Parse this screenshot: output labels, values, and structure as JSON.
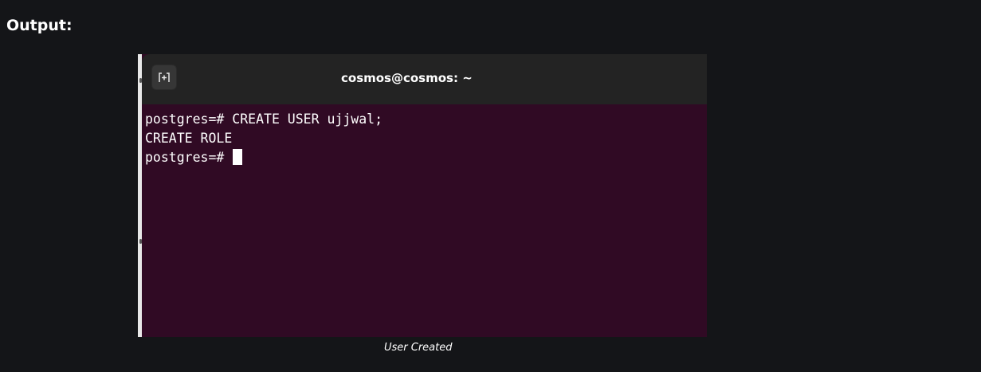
{
  "heading": "Output:",
  "terminal": {
    "window_title": "cosmos@cosmos: ~",
    "new_tab_icon": "new-tab-icon",
    "lines": [
      "postgres=# CREATE USER ujjwal;",
      "CREATE ROLE"
    ],
    "prompt": "postgres=# ",
    "colors": {
      "background": "#300a24",
      "titlebar": "#232323",
      "text": "#ffffff"
    }
  },
  "caption": "User Created",
  "page_background": "#141518"
}
